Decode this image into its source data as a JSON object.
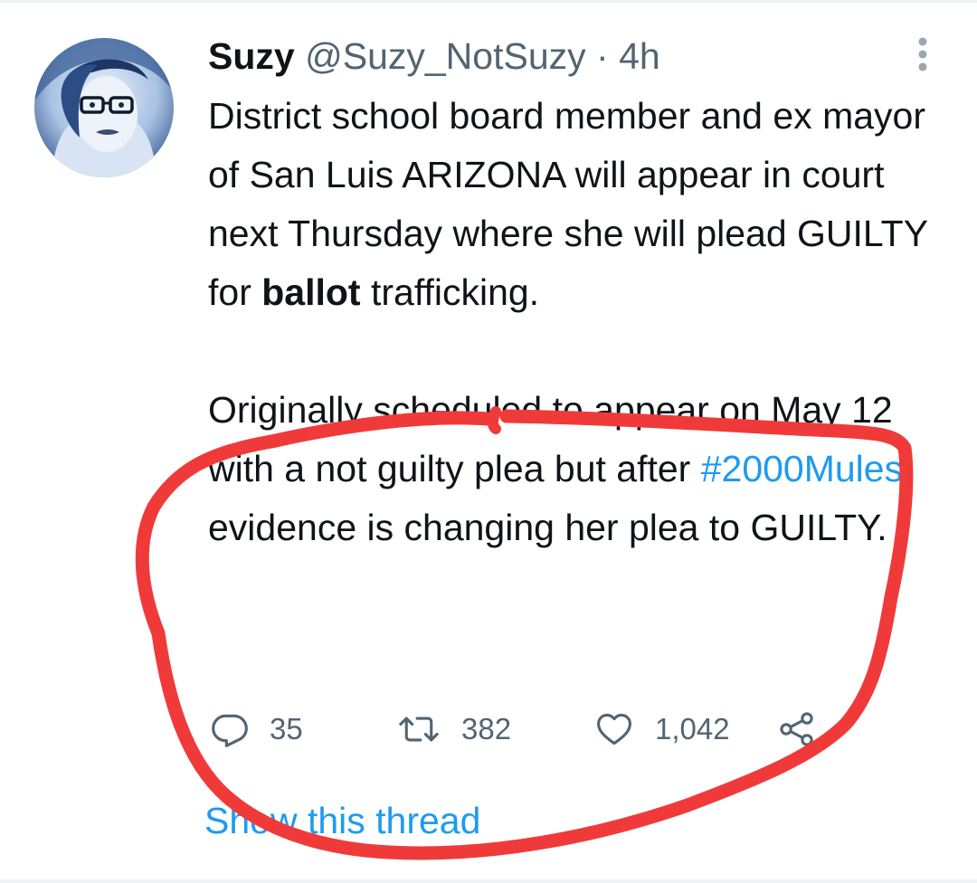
{
  "tweet": {
    "author": {
      "name": "Suzy",
      "handle": "@Suzy_NotSuzy",
      "separator": "·",
      "time": "4h"
    },
    "paragraph1": {
      "text": "District school board member and ex mayor of San Luis ARIZONA will appear in court next Thursday where she will plead GUILTY for ",
      "bold": "ballot",
      "end": " trafficking."
    },
    "paragraph2": {
      "text": "Originally scheduled to appear on May 12 with a not guilty plea but after ",
      "hashtag": "#2000Mules",
      "end": " evidence is changing her plea to GUILTY."
    },
    "actions": {
      "reply_icon": "reply-icon",
      "reply_count": "35",
      "retweet_icon": "retweet-icon",
      "retweet_count": "382",
      "like_icon": "heart-icon",
      "like_count": "1,042",
      "share_icon": "share-icon"
    },
    "show_thread": "Show this thread"
  },
  "colors": {
    "text": "#0f1419",
    "secondary": "#536471",
    "link": "#1d9bf0",
    "annotation": "#f03a3a"
  }
}
